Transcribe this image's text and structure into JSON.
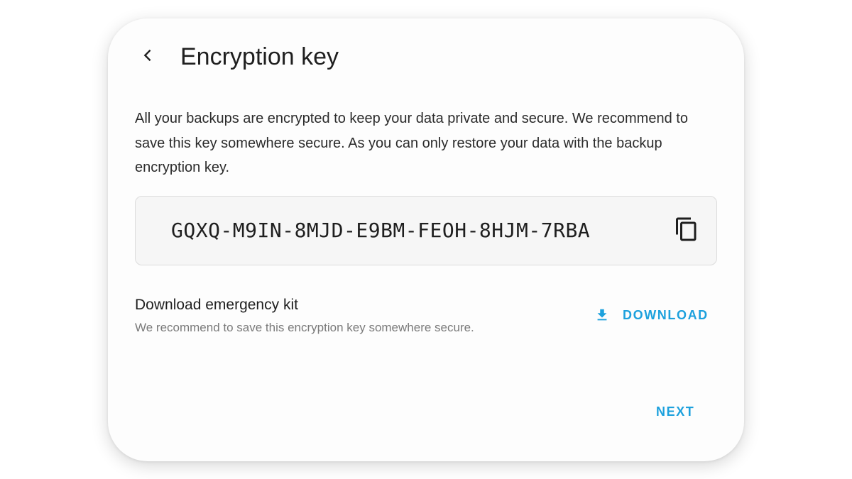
{
  "header": {
    "title": "Encryption key",
    "back_icon": "chevron-left-icon"
  },
  "body": {
    "description": "All your backups are encrypted to keep your data private and secure. We recommend to save this key somewhere secure. As you can only restore your data with the backup encryption key."
  },
  "key": {
    "value": "GQXQ-M9IN-8MJD-E9BM-FEOH-8HJM-7RBA",
    "copy_icon": "copy-icon"
  },
  "emergency_kit": {
    "title": "Download emergency kit",
    "subtitle": "We recommend to save this encryption key somewhere secure.",
    "download_label": "DOWNLOAD",
    "download_icon": "download-icon"
  },
  "footer": {
    "next_label": "NEXT"
  },
  "colors": {
    "accent": "#1da1dd",
    "text_primary": "#1f1f1f",
    "text_secondary": "#7a7a7a",
    "key_box_bg": "#f6f6f6"
  }
}
